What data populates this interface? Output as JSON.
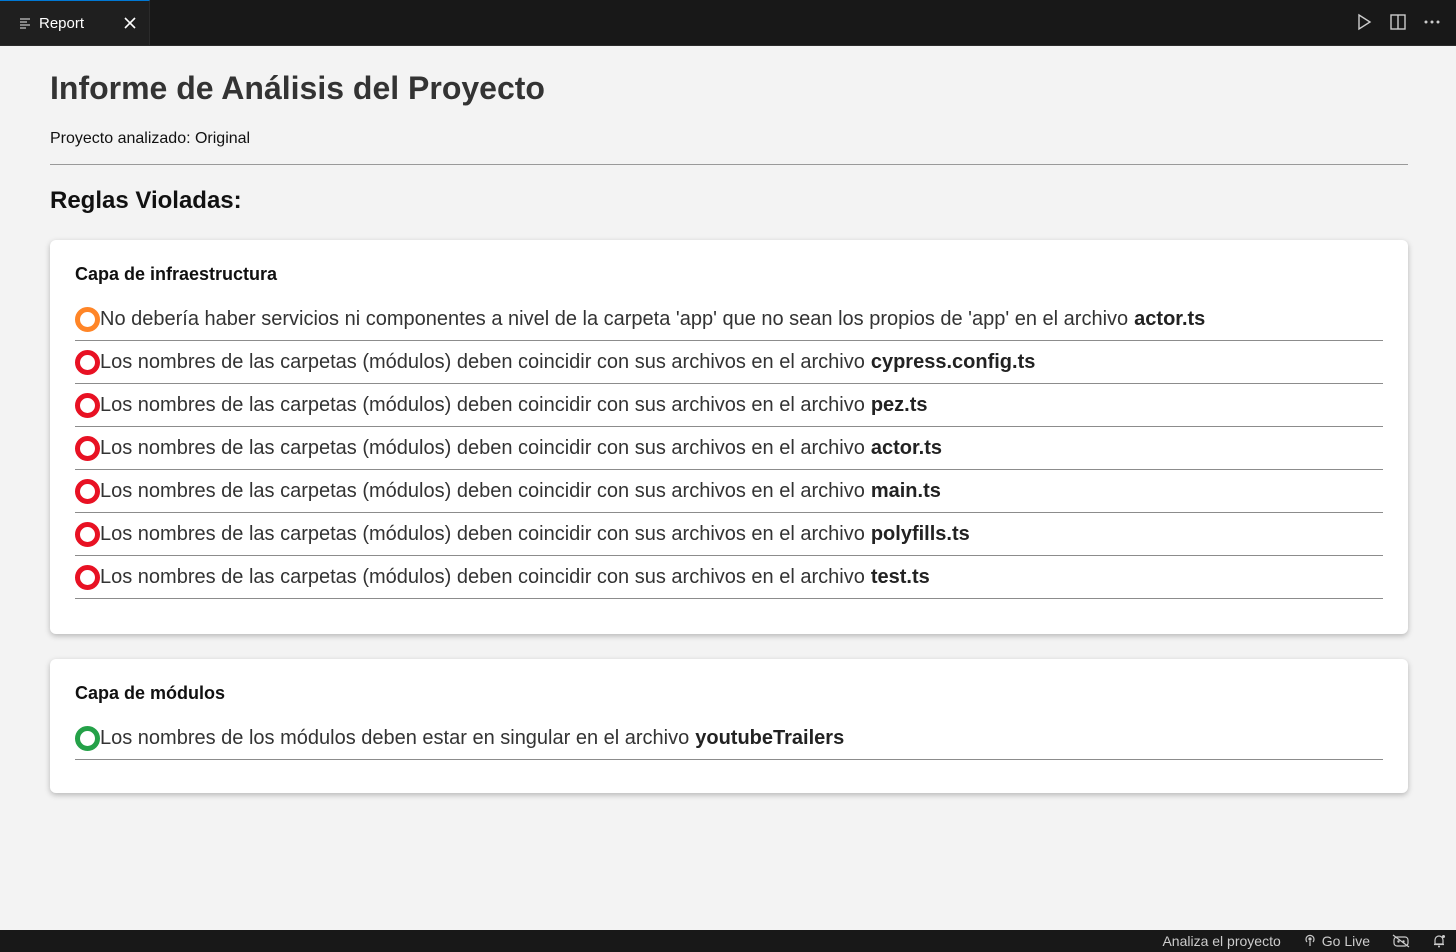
{
  "tabbar": {
    "tab_label": "Report",
    "tab_icon": "preview-lines-icon",
    "actions": [
      "run-icon",
      "split-editor-icon",
      "more-actions-icon"
    ]
  },
  "report": {
    "title": "Informe de Análisis del Proyecto",
    "project_line": "Proyecto analizado: Original",
    "violations_heading": "Reglas Violadas:"
  },
  "cards": [
    {
      "title": "Capa de infraestructura",
      "rules": [
        {
          "severity": "warning",
          "color": "#ff8527",
          "text": "No debería haber servicios ni componentes a nivel de la carpeta 'app' que no sean los propios de 'app' en el archivo",
          "file": "actor.ts"
        },
        {
          "severity": "error",
          "color": "#e81123",
          "text": "Los nombres de las carpetas (módulos) deben coincidir con sus archivos en el archivo",
          "file": "cypress.config.ts"
        },
        {
          "severity": "error",
          "color": "#e81123",
          "text": "Los nombres de las carpetas (módulos) deben coincidir con sus archivos en el archivo",
          "file": "pez.ts"
        },
        {
          "severity": "error",
          "color": "#e81123",
          "text": "Los nombres de las carpetas (módulos) deben coincidir con sus archivos en el archivo",
          "file": "actor.ts"
        },
        {
          "severity": "error",
          "color": "#e81123",
          "text": "Los nombres de las carpetas (módulos) deben coincidir con sus archivos en el archivo",
          "file": "main.ts"
        },
        {
          "severity": "error",
          "color": "#e81123",
          "text": "Los nombres de las carpetas (módulos) deben coincidir con sus archivos en el archivo",
          "file": "polyfills.ts"
        },
        {
          "severity": "error",
          "color": "#e81123",
          "text": "Los nombres de las carpetas (módulos) deben coincidir con sus archivos en el archivo",
          "file": "test.ts"
        }
      ]
    },
    {
      "title": "Capa de módulos",
      "rules": [
        {
          "severity": "info",
          "color": "#24a148",
          "text": "Los nombres de los módulos deben estar en singular en el archivo",
          "file": "youtubeTrailers"
        }
      ]
    }
  ],
  "statusbar": {
    "analyze": "Analiza el proyecto",
    "go_live": "Go Live",
    "go_live_icon": "broadcast-icon",
    "copilot_icon": "copilot-disabled-icon",
    "notifications_icon": "bell-icon"
  }
}
